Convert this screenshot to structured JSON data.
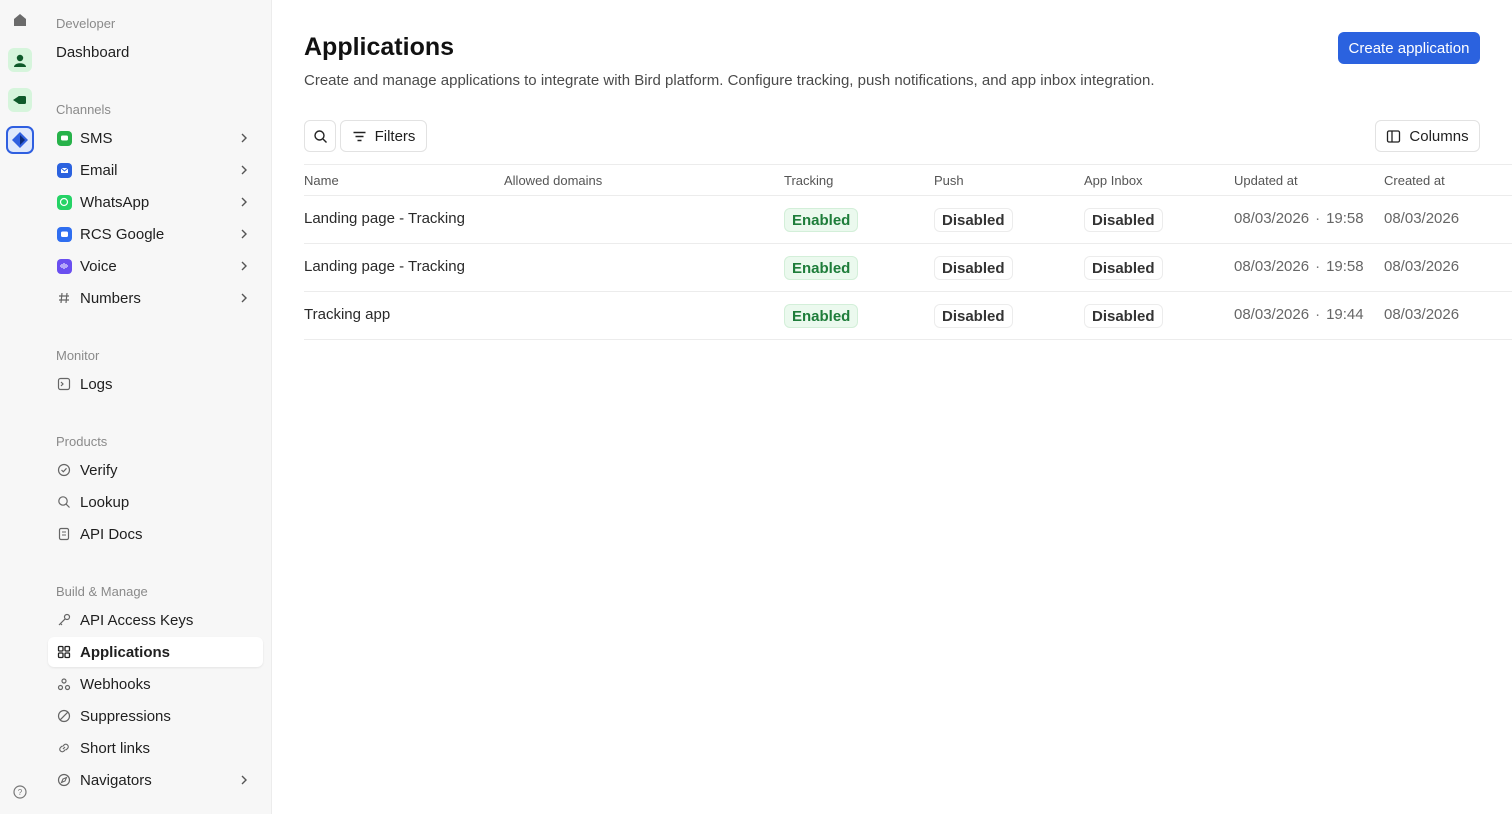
{
  "sidebar": {
    "sections": {
      "developer": "Developer",
      "channels": "Channels",
      "monitor": "Monitor",
      "products": "Products",
      "build": "Build & Manage"
    },
    "items": {
      "dashboard": "Dashboard",
      "sms": "SMS",
      "email": "Email",
      "whatsapp": "WhatsApp",
      "rcs": "RCS Google",
      "voice": "Voice",
      "numbers": "Numbers",
      "logs": "Logs",
      "verify": "Verify",
      "lookup": "Lookup",
      "apidocs": "API Docs",
      "apikeys": "API Access Keys",
      "applications": "Applications",
      "webhooks": "Webhooks",
      "suppressions": "Suppressions",
      "shortlinks": "Short links",
      "navigators": "Navigators"
    },
    "active": "applications"
  },
  "header": {
    "title": "Applications",
    "description": "Create and manage applications to integrate with Bird platform. Configure tracking, push notifications, and app inbox integration.",
    "create_label": "Create application"
  },
  "toolbar": {
    "filters_label": "Filters",
    "columns_label": "Columns"
  },
  "table": {
    "columns": {
      "name": "Name",
      "domains": "Allowed domains",
      "tracking": "Tracking",
      "push": "Push",
      "inbox": "App Inbox",
      "updated": "Updated at",
      "created": "Created at"
    },
    "rows": [
      {
        "name": "Landing page - Tracking",
        "domains": "",
        "tracking": "Enabled",
        "push": "Disabled",
        "inbox": "Disabled",
        "updated_date": "08/03/2026",
        "updated_time": "19:58",
        "created": "08/03/2026"
      },
      {
        "name": "Landing page - Tracking",
        "domains": "",
        "tracking": "Enabled",
        "push": "Disabled",
        "inbox": "Disabled",
        "updated_date": "08/03/2026",
        "updated_time": "19:58",
        "created": "08/03/2026"
      },
      {
        "name": "Tracking app",
        "domains": "",
        "tracking": "Enabled",
        "push": "Disabled",
        "inbox": "Disabled",
        "updated_date": "08/03/2026",
        "updated_time": "19:44",
        "created": "08/03/2026"
      }
    ]
  },
  "colors": {
    "accent": "#2b62df",
    "enabled_bg": "#ebf9ee",
    "enabled_text": "#1e7d3a",
    "sms": "#27b24a",
    "email": "#2b62df",
    "whatsapp": "#25d366",
    "rcs": "#2f6ef0",
    "voice": "#6a4ff0"
  },
  "icons": {
    "rail": [
      "home-icon",
      "contact-app-icon",
      "video-app-icon",
      "developer-app-icon",
      "help-icon"
    ]
  }
}
